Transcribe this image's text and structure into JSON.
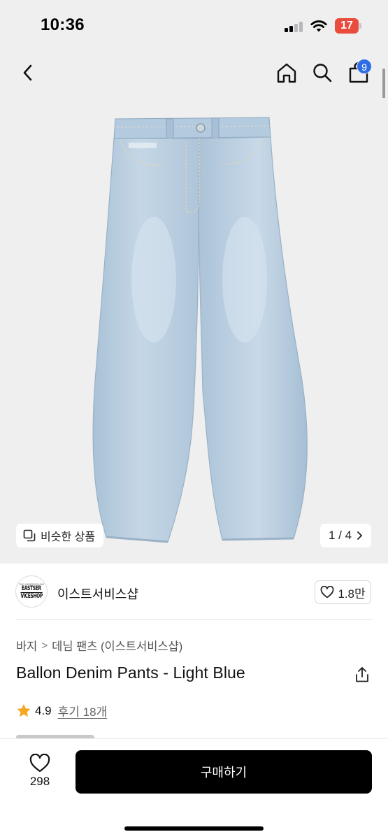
{
  "status_bar": {
    "time": "10:36",
    "battery_level": "17",
    "battery_color": "#e94b3c",
    "icons": [
      "cellular-signal-icon",
      "wifi-icon",
      "battery-icon"
    ]
  },
  "nav": {
    "back_icon": "chevron-left-icon",
    "home_icon": "home-icon",
    "search_icon": "search-icon",
    "cart_icon": "shopping-bag-icon",
    "cart_count": "9",
    "badge_color": "#2f6de6"
  },
  "gallery": {
    "similar_label": "비슷한 상품",
    "similar_icon": "copy-icon",
    "pager": "1 / 4",
    "pager_icon": "chevron-right-icon",
    "image_alt_icon": "jeans-product-image"
  },
  "seller": {
    "logo_tiny": "THE UNDERGROUND",
    "logo_line1": "EASTSER",
    "logo_line2": "VICESHOP",
    "name": "이스트서비스샵",
    "like_icon": "heart-outline-icon",
    "like_count": "1.8만"
  },
  "product": {
    "breadcrumb": [
      "바지",
      "데님 팬츠 (이스트서비스샵)"
    ],
    "breadcrumb_separator": ">",
    "title": "Ballon Denim Pants - Light Blue",
    "share_icon": "share-icon",
    "rating": "4.9",
    "rating_icon": "star-icon",
    "star_color": "#f5a623",
    "review_label": "후기 18개"
  },
  "bottom_bar": {
    "wish_icon": "heart-outline-icon",
    "wish_count": "298",
    "buy_label": "구매하기"
  }
}
